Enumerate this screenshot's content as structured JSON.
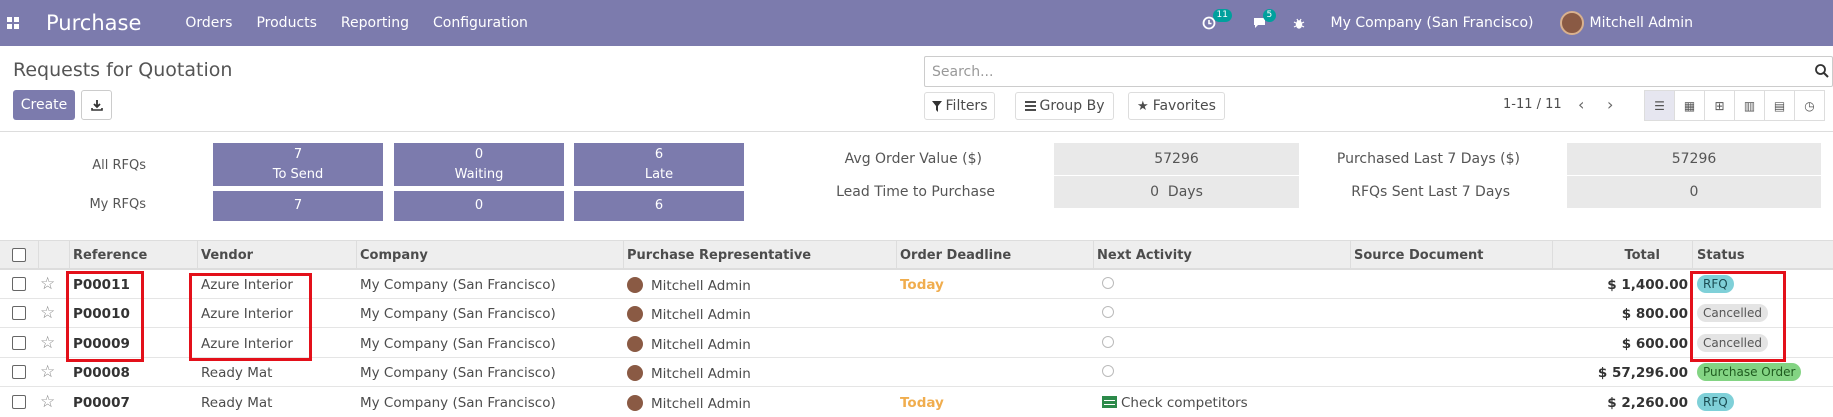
{
  "navbar": {
    "app_name": "Purchase",
    "menu": [
      "Orders",
      "Products",
      "Reporting",
      "Configuration"
    ],
    "activity_count": "11",
    "message_count": "5",
    "company": "My Company (San Francisco)",
    "user": "Mitchell Admin",
    "bg_color": "#7c7bad"
  },
  "control_panel": {
    "title": "Requests for Quotation",
    "create_label": "Create",
    "search_placeholder": "Search...",
    "filters_label": "Filters",
    "group_by_label": "Group By",
    "favorites_label": "Favorites",
    "pager": "1-11 / 11"
  },
  "dashboard": {
    "all_rfqs_label": "All RFQs",
    "my_rfqs_label": "My RFQs",
    "tiles_all": [
      {
        "count": "7",
        "label": "To Send"
      },
      {
        "count": "0",
        "label": "Waiting"
      },
      {
        "count": "6",
        "label": "Late"
      }
    ],
    "tiles_my": [
      "7",
      "0",
      "6"
    ],
    "kpis": [
      {
        "label": "Avg Order Value ($)",
        "value": "57296"
      },
      {
        "label": "Lead Time to Purchase",
        "value": "0  Days"
      },
      {
        "label": "Purchased Last 7 Days ($)",
        "value": "57296"
      },
      {
        "label": "RFQs Sent Last 7 Days",
        "value": "0"
      }
    ]
  },
  "table": {
    "headers": {
      "reference": "Reference",
      "vendor": "Vendor",
      "company": "Company",
      "rep": "Purchase Representative",
      "deadline": "Order Deadline",
      "activity": "Next Activity",
      "source": "Source Document",
      "total": "Total",
      "status": "Status"
    },
    "rows": [
      {
        "ref": "P00011",
        "vendor": "Azure Interior",
        "company": "My Company (San Francisco)",
        "rep": "Mitchell Admin",
        "deadline": "Today",
        "activity": "",
        "total": "$ 1,400.00",
        "status": "RFQ"
      },
      {
        "ref": "P00010",
        "vendor": "Azure Interior",
        "company": "My Company (San Francisco)",
        "rep": "Mitchell Admin",
        "deadline": "",
        "activity": "",
        "total": "$ 800.00",
        "status": "Cancelled"
      },
      {
        "ref": "P00009",
        "vendor": "Azure Interior",
        "company": "My Company (San Francisco)",
        "rep": "Mitchell Admin",
        "deadline": "",
        "activity": "",
        "total": "$ 600.00",
        "status": "Cancelled"
      },
      {
        "ref": "P00008",
        "vendor": "Ready Mat",
        "company": "My Company (San Francisco)",
        "rep": "Mitchell Admin",
        "deadline": "",
        "activity": "",
        "total": "$ 57,296.00",
        "status": "Purchase Order"
      },
      {
        "ref": "P00007",
        "vendor": "Ready Mat",
        "company": "My Company (San Francisco)",
        "rep": "Mitchell Admin",
        "deadline": "Today",
        "activity": "Check competitors",
        "total": "$ 2,260.00",
        "status": "RFQ"
      }
    ]
  },
  "colors": {
    "highlight": "#e3101a",
    "today": "#f0ad4e",
    "rfq": "#7fd0d8",
    "cancelled": "#e4e4e4",
    "purchase_order": "#83d483"
  }
}
